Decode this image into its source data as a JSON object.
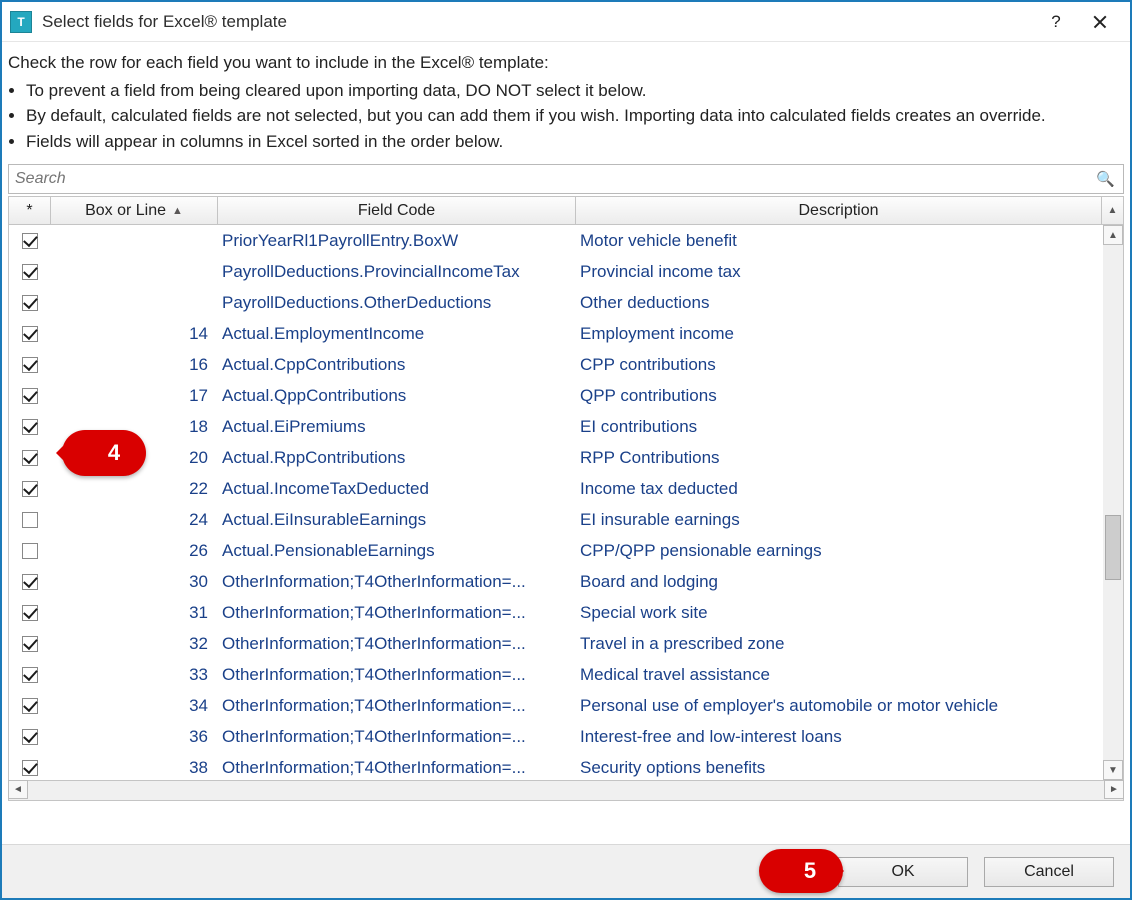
{
  "titlebar": {
    "title": "Select fields for Excel® template",
    "help": "?",
    "close": "×"
  },
  "instructions": {
    "lead": "Check the row for each field you want to include in the Excel® template:",
    "bullets": [
      "To prevent a field from being cleared upon importing data, DO NOT select it below.",
      "By default, calculated fields are not selected, but you can add them if you wish. Importing data into calculated fields creates an override.",
      "Fields will appear in columns in Excel sorted in the order below."
    ]
  },
  "search": {
    "placeholder": "Search"
  },
  "columns": {
    "star": "*",
    "box": "Box or Line",
    "code": "Field Code",
    "desc": "Description"
  },
  "rows": [
    {
      "checked": true,
      "box": "",
      "code": "PriorYearRl1PayrollEntry.BoxW",
      "desc": "Motor vehicle benefit"
    },
    {
      "checked": true,
      "box": "",
      "code": "PayrollDeductions.ProvincialIncomeTax",
      "desc": "Provincial income tax"
    },
    {
      "checked": true,
      "box": "",
      "code": "PayrollDeductions.OtherDeductions",
      "desc": "Other deductions"
    },
    {
      "checked": true,
      "box": "14",
      "code": "Actual.EmploymentIncome",
      "desc": "Employment income"
    },
    {
      "checked": true,
      "box": "16",
      "code": "Actual.CppContributions",
      "desc": "CPP contributions"
    },
    {
      "checked": true,
      "box": "17",
      "code": "Actual.QppContributions",
      "desc": "QPP contributions"
    },
    {
      "checked": true,
      "box": "18",
      "code": "Actual.EiPremiums",
      "desc": "EI contributions"
    },
    {
      "checked": true,
      "box": "20",
      "code": "Actual.RppContributions",
      "desc": "RPP Contributions"
    },
    {
      "checked": true,
      "box": "22",
      "code": "Actual.IncomeTaxDeducted",
      "desc": "Income tax deducted"
    },
    {
      "checked": false,
      "box": "24",
      "code": "Actual.EiInsurableEarnings",
      "desc": "EI insurable earnings"
    },
    {
      "checked": false,
      "box": "26",
      "code": "Actual.PensionableEarnings",
      "desc": "CPP/QPP pensionable earnings"
    },
    {
      "checked": true,
      "box": "30",
      "code": "OtherInformation;T4OtherInformation=...",
      "desc": "Board and lodging"
    },
    {
      "checked": true,
      "box": "31",
      "code": "OtherInformation;T4OtherInformation=...",
      "desc": "Special work site"
    },
    {
      "checked": true,
      "box": "32",
      "code": "OtherInformation;T4OtherInformation=...",
      "desc": "Travel in a prescribed zone"
    },
    {
      "checked": true,
      "box": "33",
      "code": "OtherInformation;T4OtherInformation=...",
      "desc": "Medical travel assistance"
    },
    {
      "checked": true,
      "box": "34",
      "code": "OtherInformation;T4OtherInformation=...",
      "desc": "Personal use of employer's automobile or motor vehicle"
    },
    {
      "checked": true,
      "box": "36",
      "code": "OtherInformation;T4OtherInformation=...",
      "desc": "Interest-free and low-interest loans"
    },
    {
      "checked": true,
      "box": "38",
      "code": "OtherInformation;T4OtherInformation=...",
      "desc": "Security options benefits"
    }
  ],
  "buttons": {
    "ok": "OK",
    "cancel": "Cancel"
  },
  "callouts": {
    "four": "4",
    "five": "5"
  }
}
